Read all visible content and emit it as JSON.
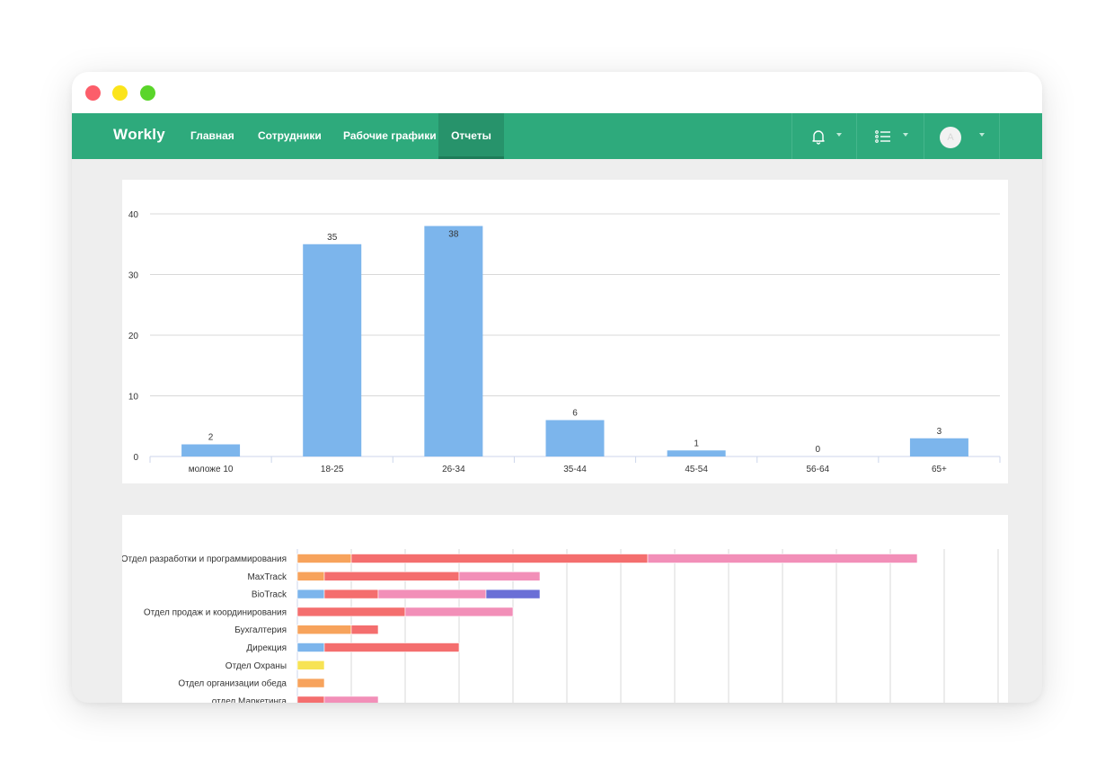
{
  "app": {
    "logo": "Wоrkly",
    "nav": [
      {
        "label": "Главная"
      },
      {
        "label": "Сотрудники"
      },
      {
        "label": "Рабочие графики"
      },
      {
        "label": "Отчеты",
        "active": true
      }
    ],
    "icons": [
      "bell-icon",
      "list-icon",
      "avatar"
    ],
    "avatar_initial": "A",
    "accent_color": "#2eaa7c"
  },
  "chart_data": [
    {
      "type": "bar",
      "categories": [
        "моложе 10",
        "18-25",
        "26-34",
        "35-44",
        "45-54",
        "56-64",
        "65+"
      ],
      "values": [
        2,
        35,
        38,
        6,
        1,
        0,
        3
      ],
      "ylim": [
        0,
        40
      ],
      "yticks": [
        0,
        10,
        20,
        30,
        40
      ],
      "grid": true,
      "color": "#7cb5ec"
    },
    {
      "type": "bar",
      "orientation": "horizontal",
      "stacked": true,
      "categories": [
        "Отдел разработки и программирования",
        "MaxTrack",
        "BioTrack",
        "Отдел продаж и координирования",
        "Бухгалтерия",
        "Дирекция",
        "Отдел Охраны",
        "Отдел организации обеда",
        "отдел Маркетинга"
      ],
      "series": [
        {
          "color": "#7cb5ec",
          "values": [
            0,
            0,
            1,
            0,
            0,
            1,
            0,
            0,
            0
          ]
        },
        {
          "color": "#f7a35c",
          "values": [
            2,
            1,
            0,
            0,
            2,
            0,
            0,
            1,
            0
          ]
        },
        {
          "color": "#f7e354",
          "values": [
            0,
            0,
            0,
            0,
            0,
            0,
            1,
            0,
            0
          ]
        },
        {
          "color": "#f46e6e",
          "values": [
            11,
            5,
            2,
            4,
            1,
            5,
            0,
            0,
            1
          ]
        },
        {
          "color": "#f28fb8",
          "values": [
            10,
            3,
            4,
            4,
            0,
            0,
            0,
            0,
            2
          ]
        },
        {
          "color": "#6a6fd6",
          "values": [
            0,
            0,
            2,
            0,
            0,
            0,
            0,
            0,
            0
          ]
        }
      ],
      "xlim": [
        0,
        26
      ],
      "grid": true
    }
  ]
}
